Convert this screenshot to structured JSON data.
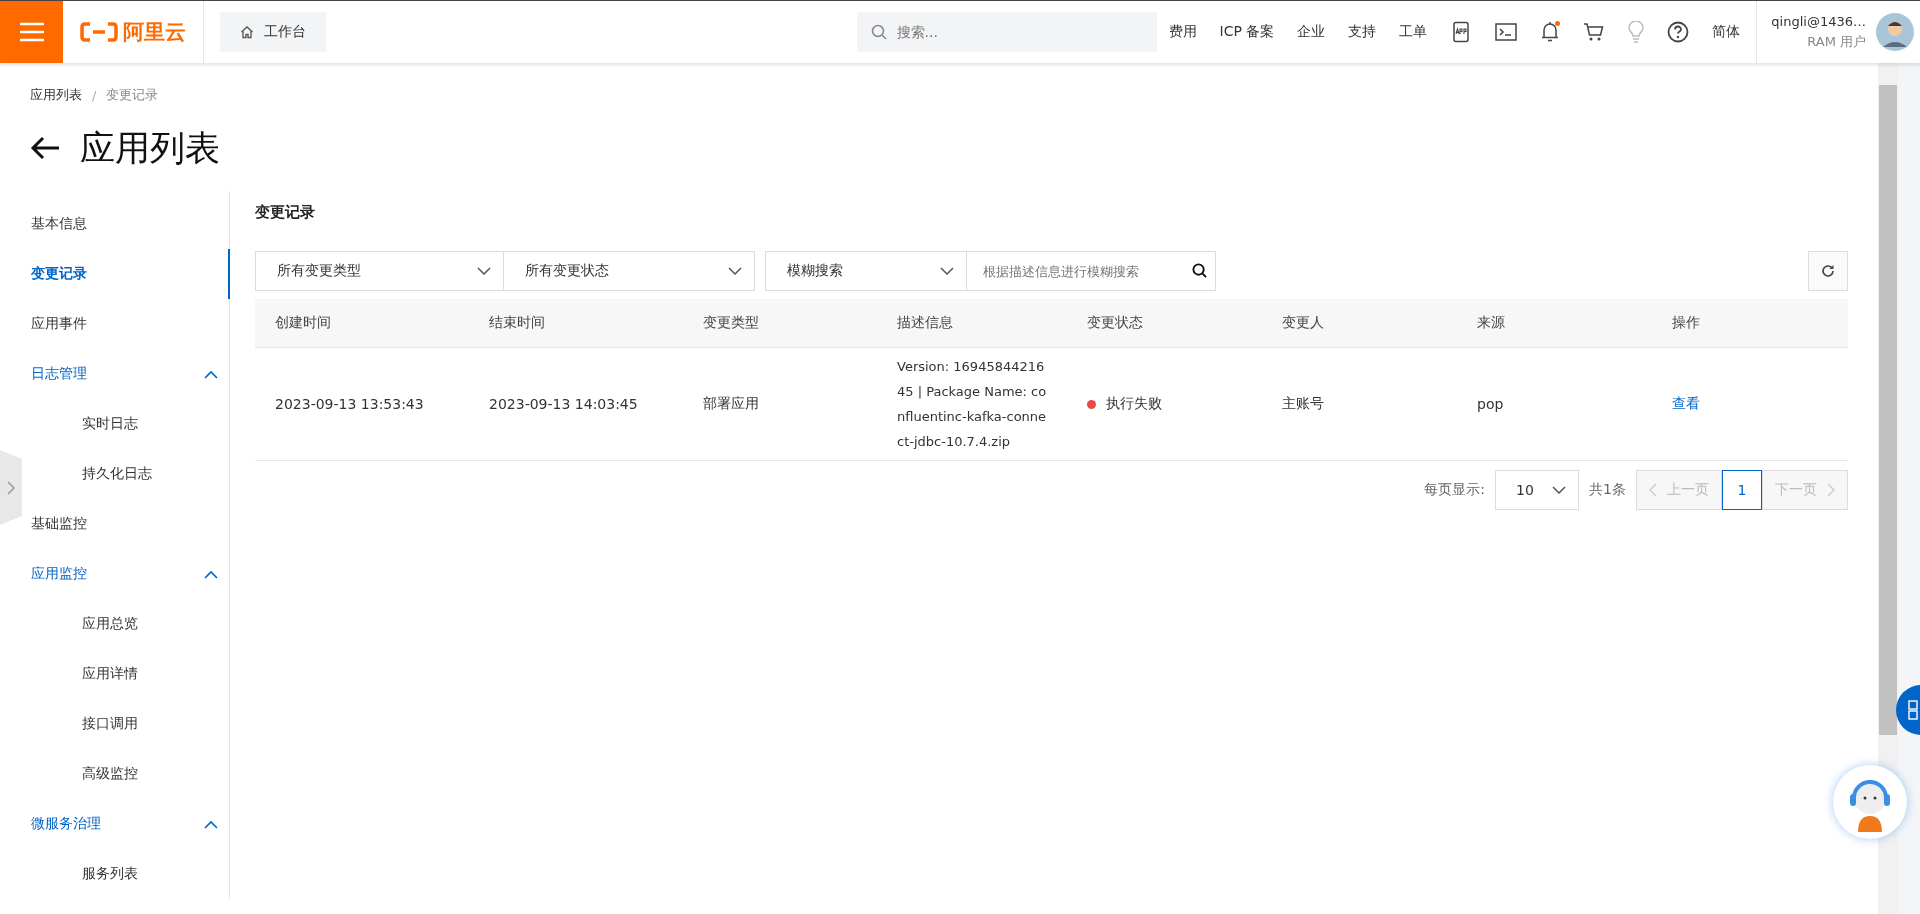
{
  "topbar": {
    "logo": "阿里云",
    "workbench": "工作台",
    "search": {
      "placeholder": "搜索..."
    },
    "links": [
      "费用",
      "ICP 备案",
      "企业",
      "支持",
      "工单"
    ],
    "notification_dot": true,
    "language": "简体",
    "user": {
      "name": "qingli@1436…",
      "role": "RAM 用户"
    }
  },
  "breadcrumb": {
    "separator": "/",
    "items": [
      {
        "label": "应用列表",
        "current": false
      },
      {
        "label": "变更记录",
        "current": true
      }
    ]
  },
  "page_title": "应用列表",
  "sidebar": {
    "items": [
      {
        "label": "基本信息",
        "selected": false
      },
      {
        "label": "变更记录",
        "selected": true
      },
      {
        "label": "应用事件",
        "selected": false
      },
      {
        "label": "日志管理",
        "selected": false,
        "expanded": true,
        "children": [
          {
            "label": "实时日志",
            "selected": false
          },
          {
            "label": "持久化日志",
            "selected": false
          }
        ]
      },
      {
        "label": "基础监控",
        "selected": false
      },
      {
        "label": "应用监控",
        "selected": false,
        "expanded": true,
        "children": [
          {
            "label": "应用总览",
            "selected": false
          },
          {
            "label": "应用详情",
            "selected": false
          },
          {
            "label": "接口调用",
            "selected": false
          },
          {
            "label": "高级监控",
            "selected": false
          }
        ]
      },
      {
        "label": "微服务治理",
        "selected": false,
        "expanded": true,
        "children": [
          {
            "label": "服务列表",
            "selected": false
          }
        ]
      }
    ]
  },
  "section_title": "变更记录",
  "filters": {
    "change_type": "所有变更类型",
    "change_status": "所有变更状态",
    "search_mode": "模糊搜索",
    "search": {
      "placeholder": "根据描述信息进行模糊搜索"
    }
  },
  "table": {
    "columns": [
      "创建时间",
      "结束时间",
      "变更类型",
      "描述信息",
      "变更状态",
      "变更人",
      "来源",
      "操作"
    ],
    "rows": [
      {
        "created": "2023-09-13 13:53:43",
        "ended": "2023-09-13 14:03:45",
        "type": "部署应用",
        "description": "Version: 1694584421645 | Package Name: confluentinc-kafka-connect-jdbc-10.7.4.zip",
        "status": {
          "label": "执行失败",
          "color": "#e84a4a"
        },
        "operator": "主账号",
        "source": "pop",
        "action": "查看"
      }
    ]
  },
  "pagination": {
    "page_size_label": "每页显示:",
    "page_size": "10",
    "total": "共1条",
    "prev": "上一页",
    "pages": [
      {
        "label": "1",
        "selected": true
      }
    ],
    "next": "下一页"
  }
}
